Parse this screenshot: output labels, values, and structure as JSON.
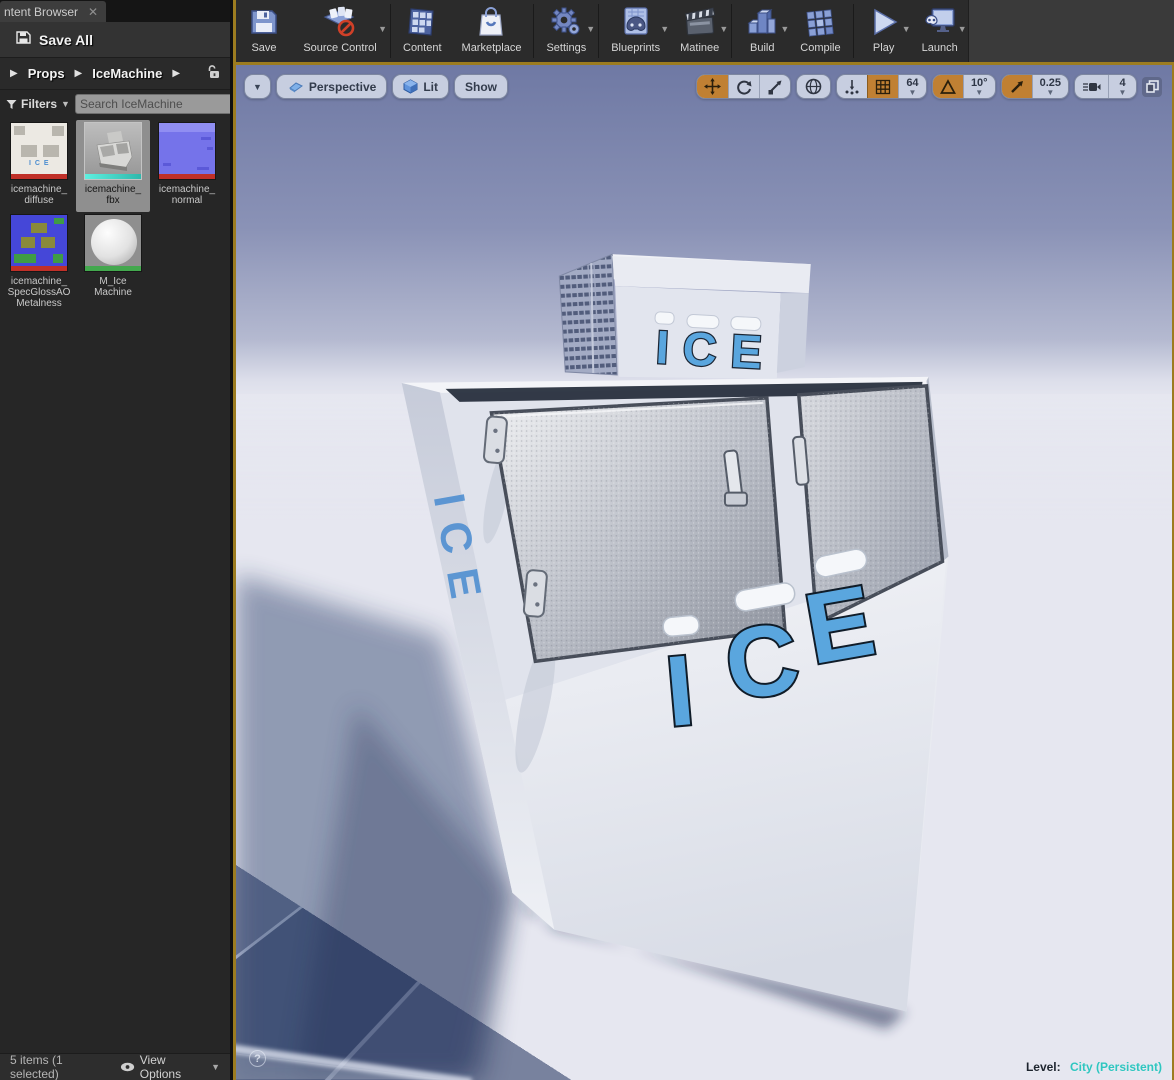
{
  "colors": {
    "accent_orange": "#c08033",
    "viewport_border_gold": "#9c7c20",
    "level_value_teal": "#2fc6c0",
    "asset_stripe_red": "#c03028",
    "asset_stripe_teal": "#3fd6c6",
    "asset_stripe_green": "#43a84e",
    "ice_letter_blue": "#5aa6de"
  },
  "content_browser": {
    "tab_title": "ntent Browser",
    "save_all": "Save All",
    "breadcrumb": {
      "root": "Props",
      "current": "IceMachine"
    },
    "filters": "Filters",
    "search_placeholder": "Search IceMachine",
    "assets": [
      {
        "lines": [
          "icemachine_",
          "diffuse"
        ]
      },
      {
        "lines": [
          "icemachine_",
          "fbx"
        ],
        "selected": true
      },
      {
        "lines": [
          "icemachine_",
          "normal"
        ]
      },
      {
        "lines": [
          "icemachine_",
          "SpecGlossAO",
          "Metalness"
        ]
      },
      {
        "lines": [
          "M_Ice",
          "Machine"
        ]
      }
    ],
    "status": "5 items (1 selected)",
    "view_options": "View Options"
  },
  "toolbar": {
    "buttons": [
      {
        "label": "Save"
      },
      {
        "label": "Source Control",
        "dropdown": true
      },
      {
        "label": "Content"
      },
      {
        "label": "Marketplace"
      },
      {
        "label": "Settings",
        "dropdown": true
      },
      {
        "label": "Blueprints",
        "dropdown": true
      },
      {
        "label": "Matinee",
        "dropdown": true
      },
      {
        "label": "Build",
        "dropdown": true
      },
      {
        "label": "Compile"
      },
      {
        "label": "Play",
        "dropdown": true
      },
      {
        "label": "Launch",
        "dropdown": true
      }
    ]
  },
  "viewport": {
    "perspective": "Perspective",
    "lit": "Lit",
    "show": "Show",
    "snap": {
      "grid": "64",
      "angle": "10°",
      "scale": "0.25",
      "camera_speed": "4"
    },
    "help_glyph": "?",
    "level_label": "Level:",
    "level_value": "City (Persistent)",
    "scene": {
      "sign_text": "ICE",
      "front_letters": [
        "I",
        "C",
        "E"
      ],
      "side_text": "ICE"
    }
  }
}
